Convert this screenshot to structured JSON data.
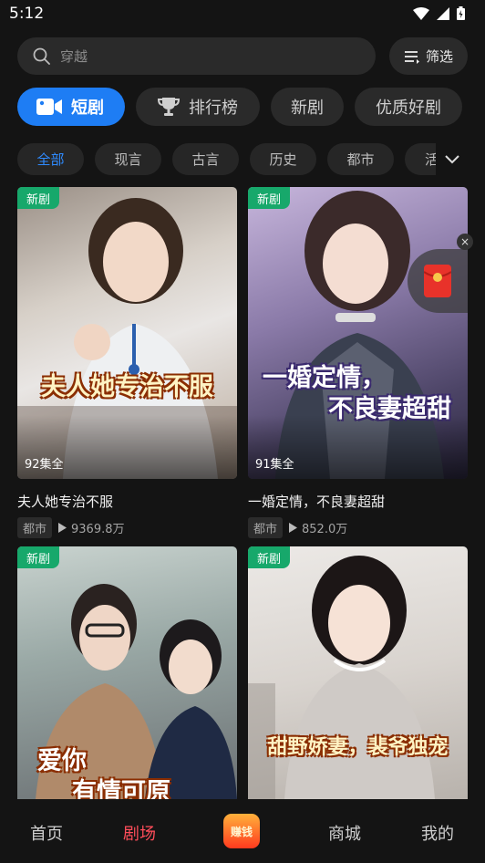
{
  "status": {
    "time": "5:12"
  },
  "search": {
    "placeholder": "穿越",
    "filter_label": "筛选"
  },
  "main_tabs": [
    {
      "label": "短剧",
      "active": true
    },
    {
      "label": "排行榜",
      "active": false
    },
    {
      "label": "新剧",
      "active": false
    },
    {
      "label": "优质好剧",
      "active": false
    }
  ],
  "categories": [
    {
      "label": "全部",
      "active": true
    },
    {
      "label": "现言"
    },
    {
      "label": "古言"
    },
    {
      "label": "历史"
    },
    {
      "label": "都市"
    },
    {
      "label": "活"
    }
  ],
  "cards": [
    {
      "badge": "新剧",
      "episodes": "92集全",
      "cover_text": [
        "夫人她专治不服"
      ],
      "title": "夫人她专治不服",
      "tag": "都市",
      "plays": "9369.8万"
    },
    {
      "badge": "新剧",
      "episodes": "91集全",
      "cover_text": [
        "一婚定情，",
        "不良妻超甜"
      ],
      "title": "一婚定情，不良妻超甜",
      "tag": "都市",
      "plays": "852.0万"
    },
    {
      "badge": "新剧",
      "cover_text": [
        "爱你",
        "有情可原"
      ]
    },
    {
      "badge": "新剧",
      "cover_text": [
        "甜野娇妻，裴爷独宠"
      ]
    }
  ],
  "float_close": "×",
  "bottom_nav": {
    "home": "首页",
    "theater": "剧场",
    "earn": "赚钱",
    "mall": "商城",
    "mine": "我的"
  },
  "colors": {
    "accent": "#1e7df4",
    "badge": "#17a86b",
    "nav_active": "#ff4d5a"
  }
}
